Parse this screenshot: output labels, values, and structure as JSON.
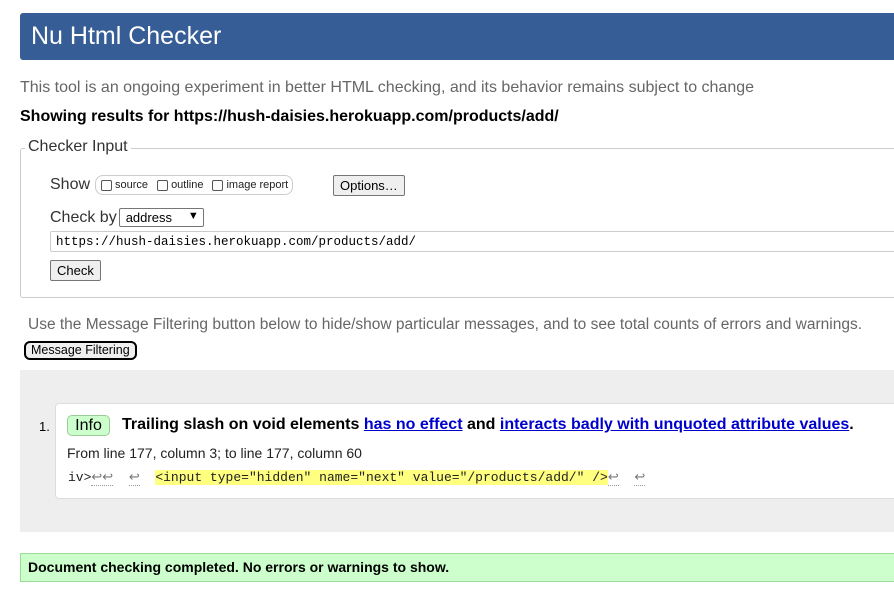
{
  "header": {
    "title": "Nu Html Checker"
  },
  "intro": "This tool is an ongoing experiment in better HTML checking, and its behavior remains subject to change",
  "results_for": "Showing results for https://hush-daisies.herokuapp.com/products/add/",
  "checker_input": {
    "legend": "Checker Input",
    "show_label": "Show",
    "options": [
      {
        "label": "source",
        "checked": false
      },
      {
        "label": "outline",
        "checked": false
      },
      {
        "label": "image report",
        "checked": false
      }
    ],
    "options_button": "Options…",
    "check_by_label": "Check by",
    "check_by_value": "address",
    "url_value": "https://hush-daisies.herokuapp.com/products/add/",
    "check_button": "Check"
  },
  "filter": {
    "note": "Use the Message Filtering button below to hide/show particular messages, and to see total counts of errors and warnings.",
    "button": "Message Filtering"
  },
  "messages": [
    {
      "number": "1.",
      "type": "Info",
      "text_before": "Trailing slash on void elements ",
      "link1": "has no effect",
      "text_middle": " and ",
      "link2": "interacts badly with unquoted attribute values",
      "text_after": ".",
      "location": "From line 177, column 3; to line 177, column 60",
      "extract_prefix": "iv>",
      "extract_highlight": "<input type=\"hidden\" name=\"next\" value=\"/products/add/\" />"
    }
  ],
  "completed": "Document checking completed. No errors or warnings to show.",
  "colors": {
    "header": "#365d95",
    "info_badge": "#ccffcc",
    "link": "#0000cc",
    "highlight": "#ffff80"
  }
}
